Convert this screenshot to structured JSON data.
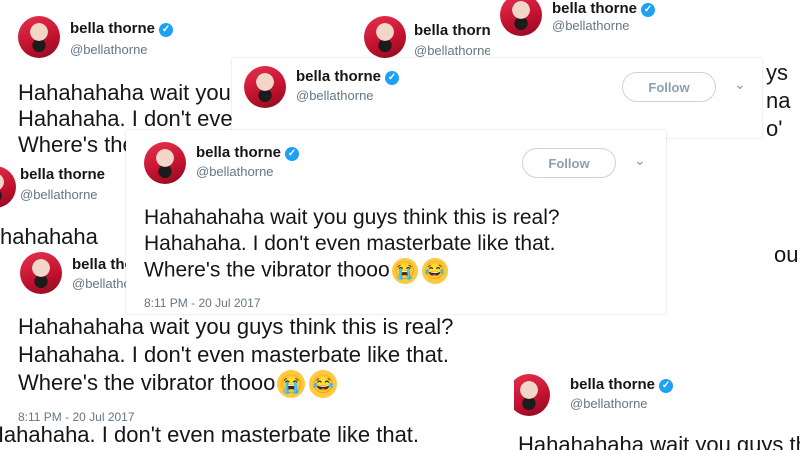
{
  "tweet": {
    "name": "bella thorne",
    "handle": "@bellathorne",
    "follow_label": "Follow",
    "line1": "Hahahahaha wait you guys think this is real?",
    "line2": "Hahahaha. I don't even masterbate like that.",
    "line3": "Where's the vibrator thooo",
    "emoji1": "😭",
    "emoji2": "😂",
    "timestamp": "8:11 PM - 20 Jul 2017"
  },
  "colors": {
    "verified": "#1da1f2",
    "follow_border": "#c9d4dd",
    "secondary_text": "#657786"
  },
  "icons": [
    "verified-badge-icon",
    "chevron-down-icon",
    "avatar"
  ]
}
